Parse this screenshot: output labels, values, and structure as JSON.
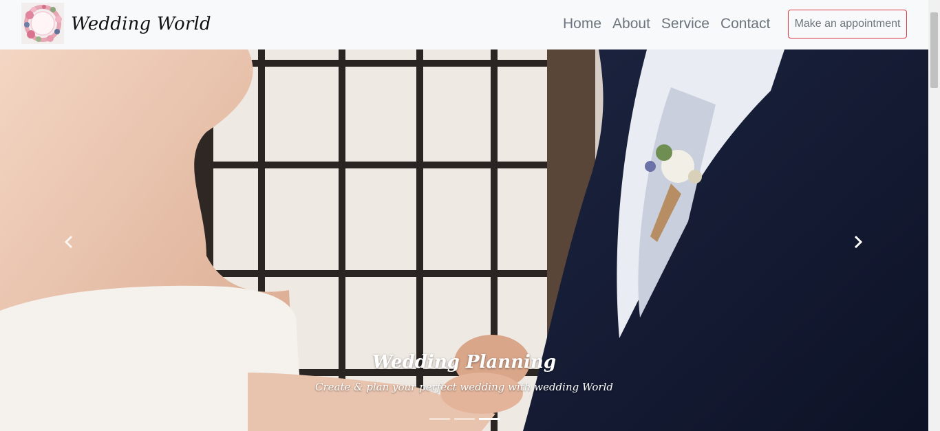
{
  "brand": {
    "name": "Wedding World",
    "logo_icon": "floral-wreath-icon"
  },
  "nav": {
    "items": [
      {
        "label": "Home"
      },
      {
        "label": "About"
      },
      {
        "label": "Service"
      },
      {
        "label": "Contact"
      }
    ],
    "cta_label": "Make an appointment"
  },
  "carousel": {
    "caption_title": "Wedding Planning",
    "caption_subtitle": "Create & plan your perfect wedding with wedding World",
    "prev_icon": "chevron-left-icon",
    "next_icon": "chevron-right-icon",
    "slide_count": 3,
    "active_index": 2
  },
  "colors": {
    "navbar_bg": "#f8f9fa",
    "nav_text": "#6c757d",
    "cta_border": "#dc3545",
    "caption_text": "#ffffff"
  }
}
